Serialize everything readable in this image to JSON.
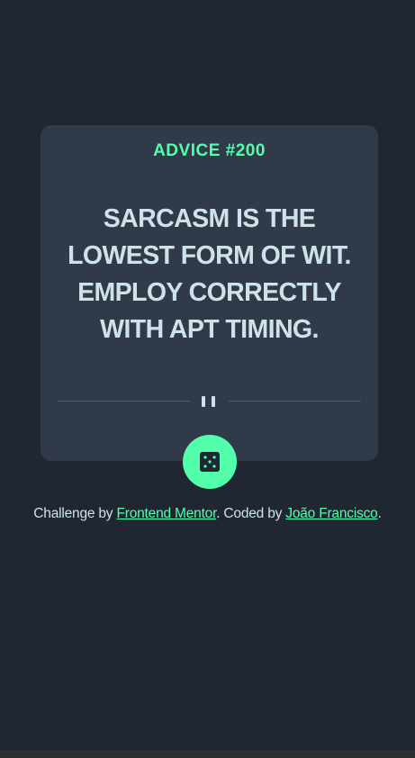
{
  "card": {
    "advice_id": "ADVICE #200",
    "advice_text": "SARCASM IS THE LOWEST FORM OF WIT. EMPLOY CORRECTLY WITH APT TIMING."
  },
  "icons": {
    "divider": "pause-icon",
    "dice_button": "dice-icon"
  },
  "attribution": {
    "prefix": "Challenge by ",
    "challenge_link": "Frontend Mentor",
    "middle": ". Coded by ",
    "author_link": "João Francisco",
    "suffix": "."
  },
  "colors": {
    "background": "#202632",
    "card": "#313a48",
    "accent": "#53ffaa",
    "text": "#cee3e9",
    "divider": "#4f5d74"
  }
}
